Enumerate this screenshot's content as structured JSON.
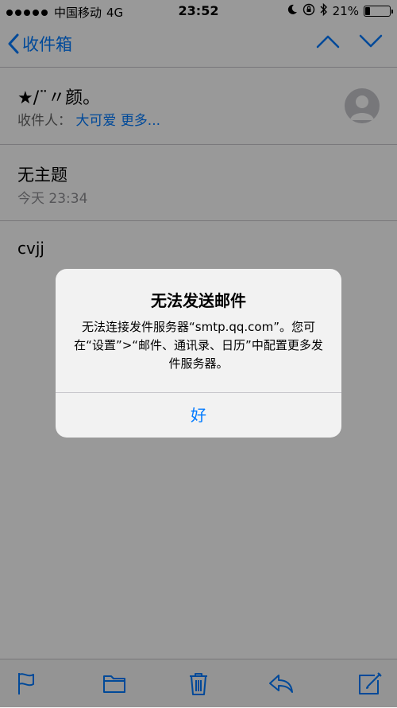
{
  "status_bar": {
    "carrier": "中国移动",
    "network": "4G",
    "time": "23:52",
    "battery": "21%",
    "battery_level": 0.21,
    "signal_bars": 5
  },
  "nav": {
    "back_label": "收件箱",
    "accent_color": "#007aff"
  },
  "message": {
    "sender": "★/¨〃颜。",
    "recipients_label": "收件人：",
    "recipient": "大可爱",
    "more": "更多...",
    "subject": "无主题",
    "date": "今天 23:34",
    "body": "cvjj"
  },
  "alert": {
    "title": "无法发送邮件",
    "message": "无法连接发件服务器“smtp.qq.com”。您可在“设置”>“邮件、通讯录、日历”中配置更多发件服务器。",
    "button": "好"
  },
  "toolbar": {
    "icons": [
      "flag-icon",
      "folder-icon",
      "trash-icon",
      "reply-icon",
      "compose-icon"
    ]
  }
}
